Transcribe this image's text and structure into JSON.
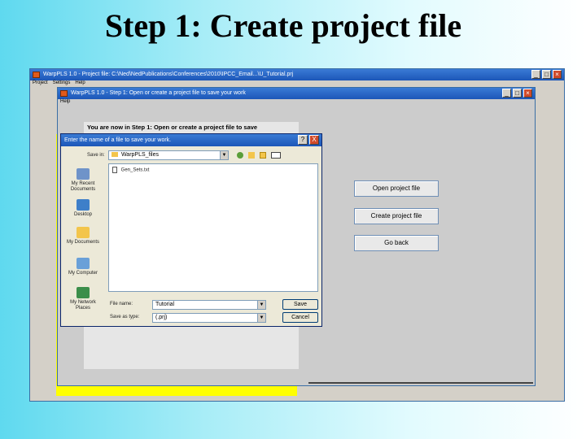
{
  "slide": {
    "title": "Step 1: Create project file"
  },
  "main_window": {
    "title": "WarpPLS 1.0 - Project file: C:\\Ned\\NedPublications\\Conferences\\2010\\IPCC_Email...\\U_Tutorial.prj",
    "menu": [
      "Project",
      "Settings",
      "Help"
    ]
  },
  "step_window": {
    "title": "WarpPLS 1.0 - Step 1: Open or create a project file to save your work",
    "menu": [
      "Help"
    ],
    "instruction": "You are now in Step 1: Open or create a project file to save",
    "buttons": {
      "open": "Open project file",
      "create": "Create project file",
      "back": "Go back"
    }
  },
  "save_dialog": {
    "title": "Enter the name of a file to save your work.",
    "save_in_label": "Save in:",
    "save_in_value": "WarpPLS_files",
    "files": [
      "Gen_Sets.txt"
    ],
    "places": [
      "My Recent Documents",
      "Desktop",
      "My Documents",
      "My Computer",
      "My Network Places"
    ],
    "file_name_label": "File name:",
    "file_name_value": "Tutorial",
    "save_as_type_label": "Save as type:",
    "save_as_type_value": "(.prj)",
    "save_button": "Save",
    "cancel_button": "Cancel",
    "help_button": "?",
    "close_button": "X"
  }
}
